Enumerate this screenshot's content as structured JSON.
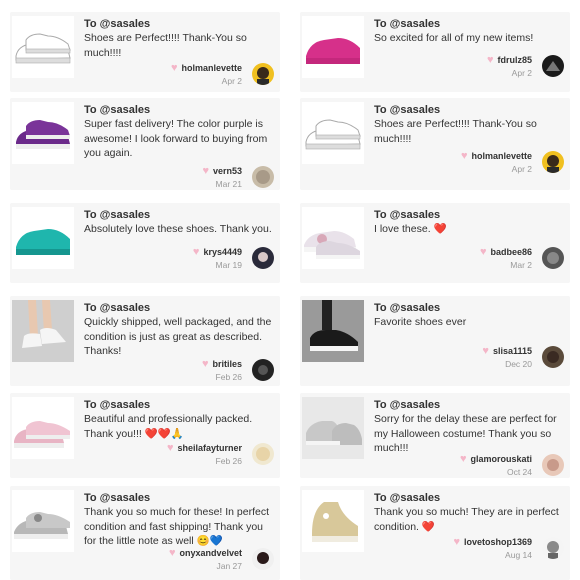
{
  "cards": [
    {
      "to": "To @sasales",
      "message": "Shoes are Perfect!!!! Thank-You so much!!!!",
      "username": "holmanlevette",
      "date": "Apr 2",
      "shoe_color": "#ffffff",
      "avatar_color": "#3a2a1a"
    },
    {
      "to": "To @sasales",
      "message": "So excited for all of my new items!",
      "username": "fdrulz85",
      "date": "Apr 2",
      "shoe_color": "#d6308a",
      "avatar_color": "#1a1a1a"
    },
    {
      "to": "To @sasales",
      "message": "Super fast delivery! The color purple is awesome! I look forward to buying from you again.",
      "username": "vern53",
      "date": "Mar 21",
      "shoe_color": "#6b2a8a",
      "avatar_color": "#a89a88"
    },
    {
      "to": "To @sasales",
      "message": "Shoes are Perfect!!!! Thank-You so much!!!!",
      "username": "holmanlevette",
      "date": "Apr 2",
      "shoe_color": "#ffffff",
      "avatar_color": "#3a2a1a"
    },
    {
      "to": "To @sasales",
      "message": "Absolutely love these shoes. Thank you.",
      "username": "krys4449",
      "date": "Mar 19",
      "shoe_color": "#1fb6ad",
      "avatar_color": "#2a2a3a"
    },
    {
      "to": "To @sasales",
      "message": "I love these. ❤️",
      "username": "badbee86",
      "date": "Mar 2",
      "shoe_color": "#e9e2ea",
      "avatar_color": "#555555"
    },
    {
      "to": "To @sasales",
      "message": "Quickly shipped, well packaged, and the condition is just as great as described. Thanks!",
      "username": "britiles",
      "date": "Feb 26",
      "shoe_color": "#f2f2f2",
      "avatar_color": "#222222"
    },
    {
      "to": "To @sasales",
      "message": "Favorite shoes ever",
      "username": "slisa1115",
      "date": "Dec 20",
      "shoe_color": "#1a1a1a",
      "avatar_color": "#3a2a22"
    },
    {
      "to": "To @sasales",
      "message": "Beautiful and professionally packed. Thank you!!! ❤️❤️🙏",
      "username": "sheilafayturner",
      "date": "Feb 26",
      "shoe_color": "#e8b4c4",
      "avatar_color": "#e8d4a8"
    },
    {
      "to": "To @sasales",
      "message": "Sorry for the delay these are perfect for my Halloween costume! Thank you so much!!!",
      "username": "glamorouskati",
      "date": "Oct 24",
      "shoe_color": "#c8c8c8",
      "avatar_color": "#c89a8a"
    },
    {
      "to": "To @sasales",
      "message": "Thank you so much for these! In perfect condition and fast shipping! Thank you for the little note as well 😊💙",
      "username": "onyxandvelvet",
      "date": "Jan 27",
      "shoe_color": "#b8b8b8",
      "avatar_color": "#2a1a1a"
    },
    {
      "to": "To @sasales",
      "message": "Thank you so much! They are in perfect condition. ❤️",
      "username": "lovetoshop1369",
      "date": "Aug 14",
      "shoe_color": "#d8c89a",
      "avatar_color": "#8a8a8a"
    }
  ]
}
